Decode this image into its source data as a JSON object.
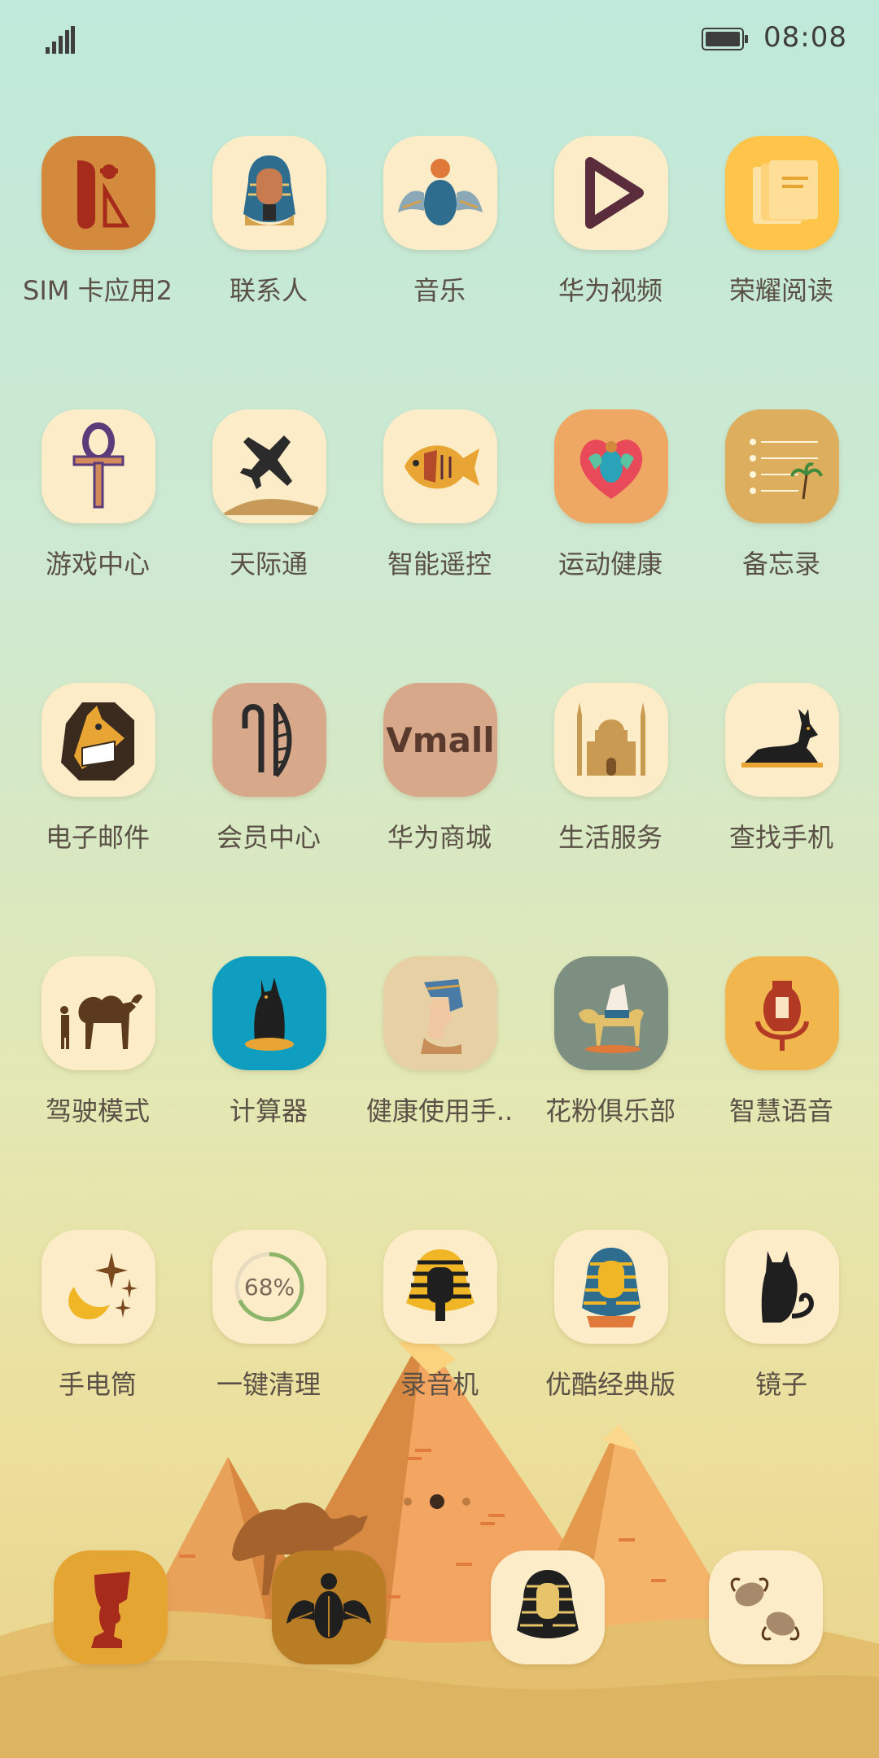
{
  "status": {
    "time": "08:08"
  },
  "apps": [
    {
      "label": "SIM 卡应用2",
      "icon": "sim-card-icon",
      "bg": "#d38a3c"
    },
    {
      "label": "联系人",
      "icon": "pharaoh-bust-icon",
      "bg": "#fdecc8"
    },
    {
      "label": "音乐",
      "icon": "winged-scarab-icon",
      "bg": "#fdecc8"
    },
    {
      "label": "华为视频",
      "icon": "play-icon",
      "bg": "#fdecc8"
    },
    {
      "label": "荣耀阅读",
      "icon": "book-icon",
      "bg": "#ffc44a"
    },
    {
      "label": "游戏中心",
      "icon": "ankh-icon",
      "bg": "#fdecc8"
    },
    {
      "label": "天际通",
      "icon": "airplane-icon",
      "bg": "#fdecc8"
    },
    {
      "label": "智能遥控",
      "icon": "fish-icon",
      "bg": "#fdecc8"
    },
    {
      "label": "运动健康",
      "icon": "scarab-heart-icon",
      "bg": "#efa864"
    },
    {
      "label": "备忘录",
      "icon": "notes-palm-icon",
      "bg": "#dcae5e"
    },
    {
      "label": "电子邮件",
      "icon": "anubis-head-icon",
      "bg": "#fdecc8"
    },
    {
      "label": "会员中心",
      "icon": "hieroglyph-icon",
      "bg": "#d7a88a"
    },
    {
      "label": "华为商城",
      "icon": "vmall-icon",
      "bg": "#d7a88a",
      "text": "Vmall"
    },
    {
      "label": "生活服务",
      "icon": "mosque-icon",
      "bg": "#fdecc8"
    },
    {
      "label": "查找手机",
      "icon": "anubis-jackal-icon",
      "bg": "#fdecc8"
    },
    {
      "label": "驾驶模式",
      "icon": "camel-rider-icon",
      "bg": "#fdecc8"
    },
    {
      "label": "计算器",
      "icon": "bastet-cat-icon",
      "bg": "#109ec0"
    },
    {
      "label": "健康使用手..",
      "icon": "nefertiti-icon",
      "bg": "#e7d0a4"
    },
    {
      "label": "花粉俱乐部",
      "icon": "camel-trader-icon",
      "bg": "#7d8f80"
    },
    {
      "label": "智慧语音",
      "icon": "vase-mic-icon",
      "bg": "#f1b64e"
    },
    {
      "label": "手电筒",
      "icon": "moon-stars-icon",
      "bg": "#fdecc8"
    },
    {
      "label": "一键清理",
      "icon": "cleanup-ring-icon",
      "bg": "#fdecc8",
      "text": "68%"
    },
    {
      "label": "录音机",
      "icon": "pharaoh-mask-icon",
      "bg": "#fdecc8"
    },
    {
      "label": "优酷经典版",
      "icon": "tutankhamun-icon",
      "bg": "#fdecc8"
    },
    {
      "label": "镜子",
      "icon": "black-cat-icon",
      "bg": "#fdecc8"
    }
  ],
  "dock": [
    {
      "icon": "nefertiti-silhouette-icon",
      "bg": "#e5a532"
    },
    {
      "icon": "winged-beetle-icon",
      "bg": "#b97d26"
    },
    {
      "icon": "pharaoh-head-icon",
      "bg": "#fdecc8"
    },
    {
      "icon": "dung-beetles-icon",
      "bg": "#fdecc8"
    }
  ],
  "pages": {
    "count": 3,
    "active": 2
  },
  "colors": {
    "accent": "#d38a3c",
    "label": "#5a5046",
    "tile": "#fdecc8"
  }
}
